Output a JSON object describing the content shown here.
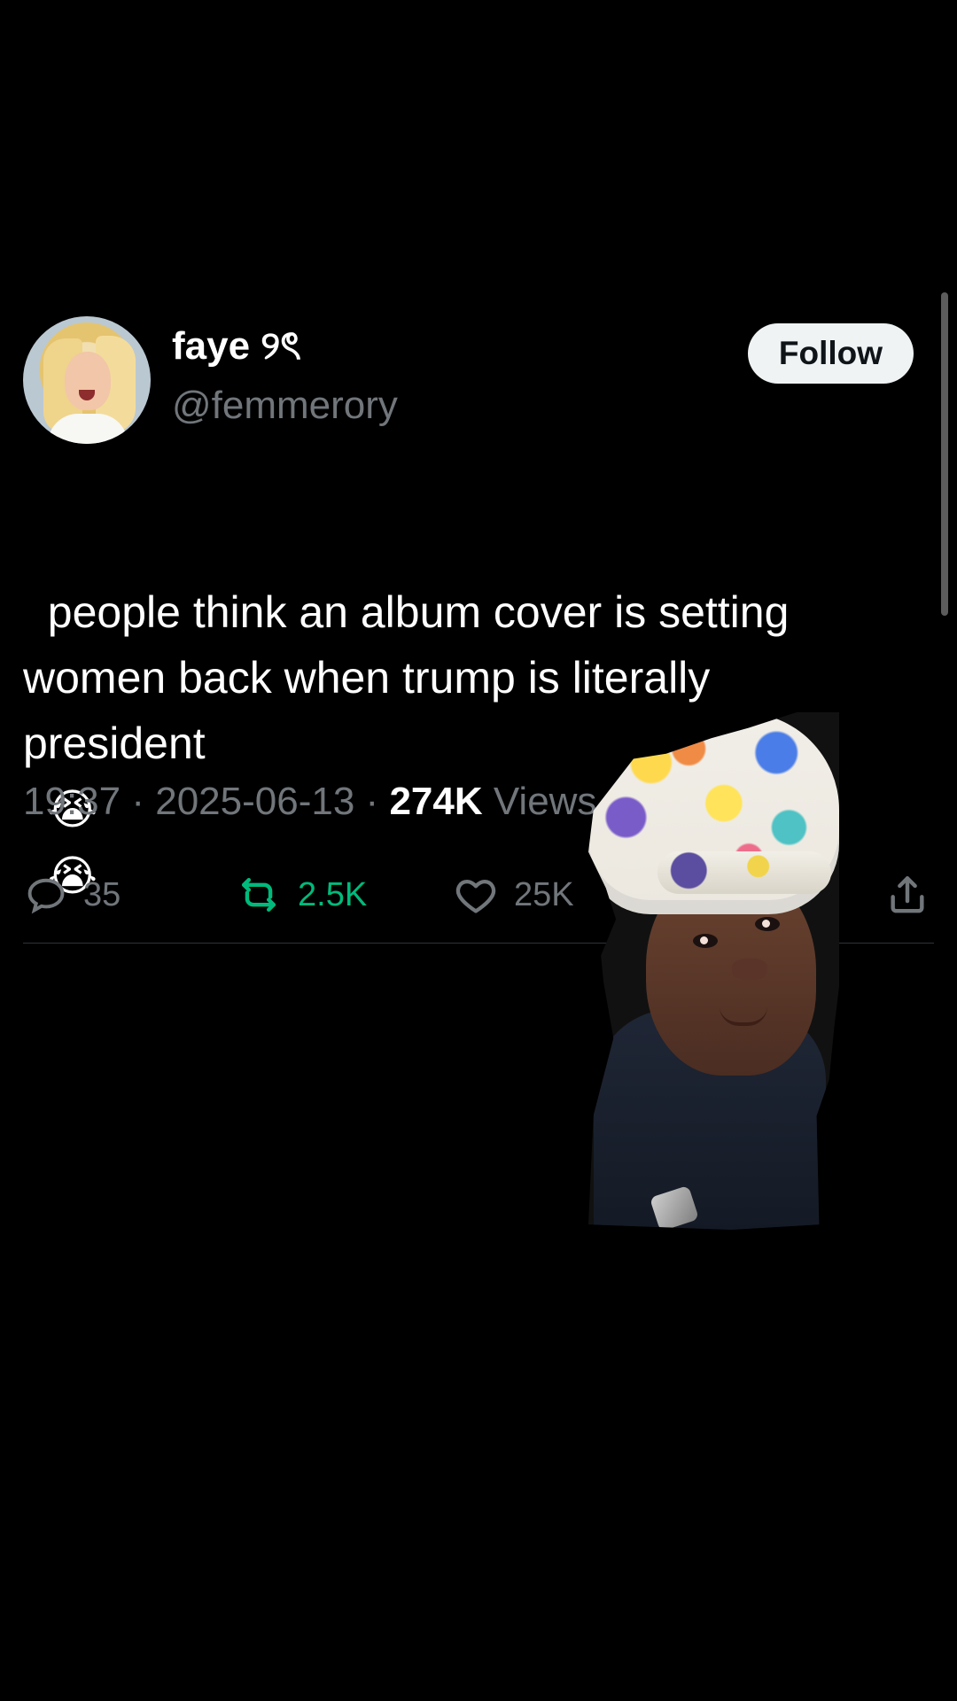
{
  "post": {
    "display_name": "faye ୨ৎ",
    "handle": "@femmerory",
    "follow_label": "Follow",
    "text": "people think an album cover is setting women back when trump is literally president",
    "emoji_1": "😭",
    "emoji_2": "😭",
    "time": "19:37",
    "date": "2025-06-13",
    "views_count": "274K",
    "views_label": "Views",
    "reply_count": "35",
    "retweet_count": "2.5K",
    "like_count": "25K"
  },
  "icons": {
    "reply": "reply-icon",
    "retweet": "retweet-icon",
    "like": "heart-icon",
    "share": "share-icon"
  },
  "colors": {
    "background": "#000000",
    "text": "#ffffff",
    "secondary_text": "#71767b",
    "retweet_accent": "#00ba7c",
    "follow_button_bg": "#eff3f4",
    "follow_button_text": "#0f1419",
    "divider": "#2f3336"
  }
}
